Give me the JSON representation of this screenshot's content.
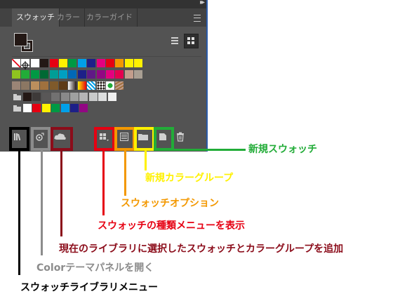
{
  "panel": {
    "collapse_glyph": "▸▸",
    "tabs": [
      {
        "label": "スウォッチ",
        "active": true
      },
      {
        "label": "カラー",
        "active": false
      },
      {
        "label": "カラーガイド",
        "active": false
      }
    ],
    "fill_color": "#231815",
    "swatch_rows": [
      {
        "folder": false,
        "colors": [
          "none",
          "registration",
          "#ffffff",
          "#231815",
          "#e60012",
          "#fff100",
          "#009944",
          "#00a0e9",
          "#1d2088",
          "#e4007f",
          "#e60012",
          "#f39800",
          "#fff100",
          "#fff100"
        ]
      },
      {
        "folder": false,
        "colors": [
          "#8fc31f",
          "#22ac38",
          "#009944",
          "#006934",
          "#009e96",
          "#00a0c1",
          "#0068b7",
          "#1d2088",
          "#601986",
          "#920783",
          "#e4007f",
          "#e5004f",
          "#c39d8c",
          "#a99f93"
        ]
      },
      {
        "folder": false,
        "colors": [
          "#9a8576",
          "#8b7763",
          "#bc8f5d",
          "#a0713e",
          "#7f5a2b",
          "#5e3b17",
          "gradient-gray",
          "gradient-orange",
          "pattern-blue",
          "pattern-dots",
          "pattern-green",
          "pattern-leaf"
        ]
      },
      {
        "folder": true,
        "colors": [
          "#231815",
          "#3e3a39",
          "#595757",
          "#727171",
          "#898989",
          "#9fa0a0",
          "#b5b5b6",
          "#c9caca",
          "#dcdddd",
          "#efefef"
        ]
      },
      {
        "folder": true,
        "colors": [
          "#ffffff",
          "#e60012",
          "#fff100",
          "#009944",
          "#00a0e9",
          "#1d2088",
          "#920783"
        ]
      }
    ]
  },
  "callouts": [
    {
      "text": "新規スウォッチ",
      "color": "#22ac38"
    },
    {
      "text": "新規カラーグループ",
      "color": "#fff100"
    },
    {
      "text": "スウォッチオプション",
      "color": "#f39800"
    },
    {
      "text": "スウォッチの種類メニューを表示",
      "color": "#e60012"
    },
    {
      "text": "現在のライブラリに選択したスウォッチとカラーグループを追加",
      "color": "#8b0c1a"
    },
    {
      "text": "Colorテーマパネルを開く",
      "color": "#8c8c8c"
    },
    {
      "text": "スウォッチライブラリメニュー",
      "color": "#000000"
    }
  ]
}
